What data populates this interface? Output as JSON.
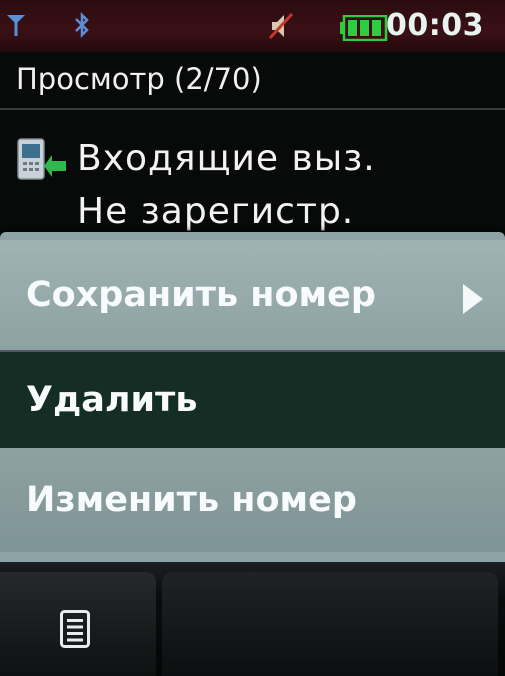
{
  "status_bar": {
    "time": "00:03",
    "icons": [
      "signal-icon",
      "bluetooth-icon",
      "muted-sound-icon",
      "battery-full-icon"
    ],
    "battery_color": "#2ecc40"
  },
  "header": {
    "title": "Просмотр (2/70)"
  },
  "entry": {
    "icon": "incoming-call-icon",
    "type": "Входящие выз.",
    "number": "Не зарегистр."
  },
  "menu": {
    "items": [
      {
        "label": "Сохранить номер",
        "has_submenu": true
      },
      {
        "label": "Удалить",
        "selected": true
      },
      {
        "label": "Изменить номер"
      }
    ],
    "background_color": "#8ea3a5",
    "selected_color": "#142d25"
  },
  "softkeys": {
    "left_icon": "options-list-icon"
  }
}
